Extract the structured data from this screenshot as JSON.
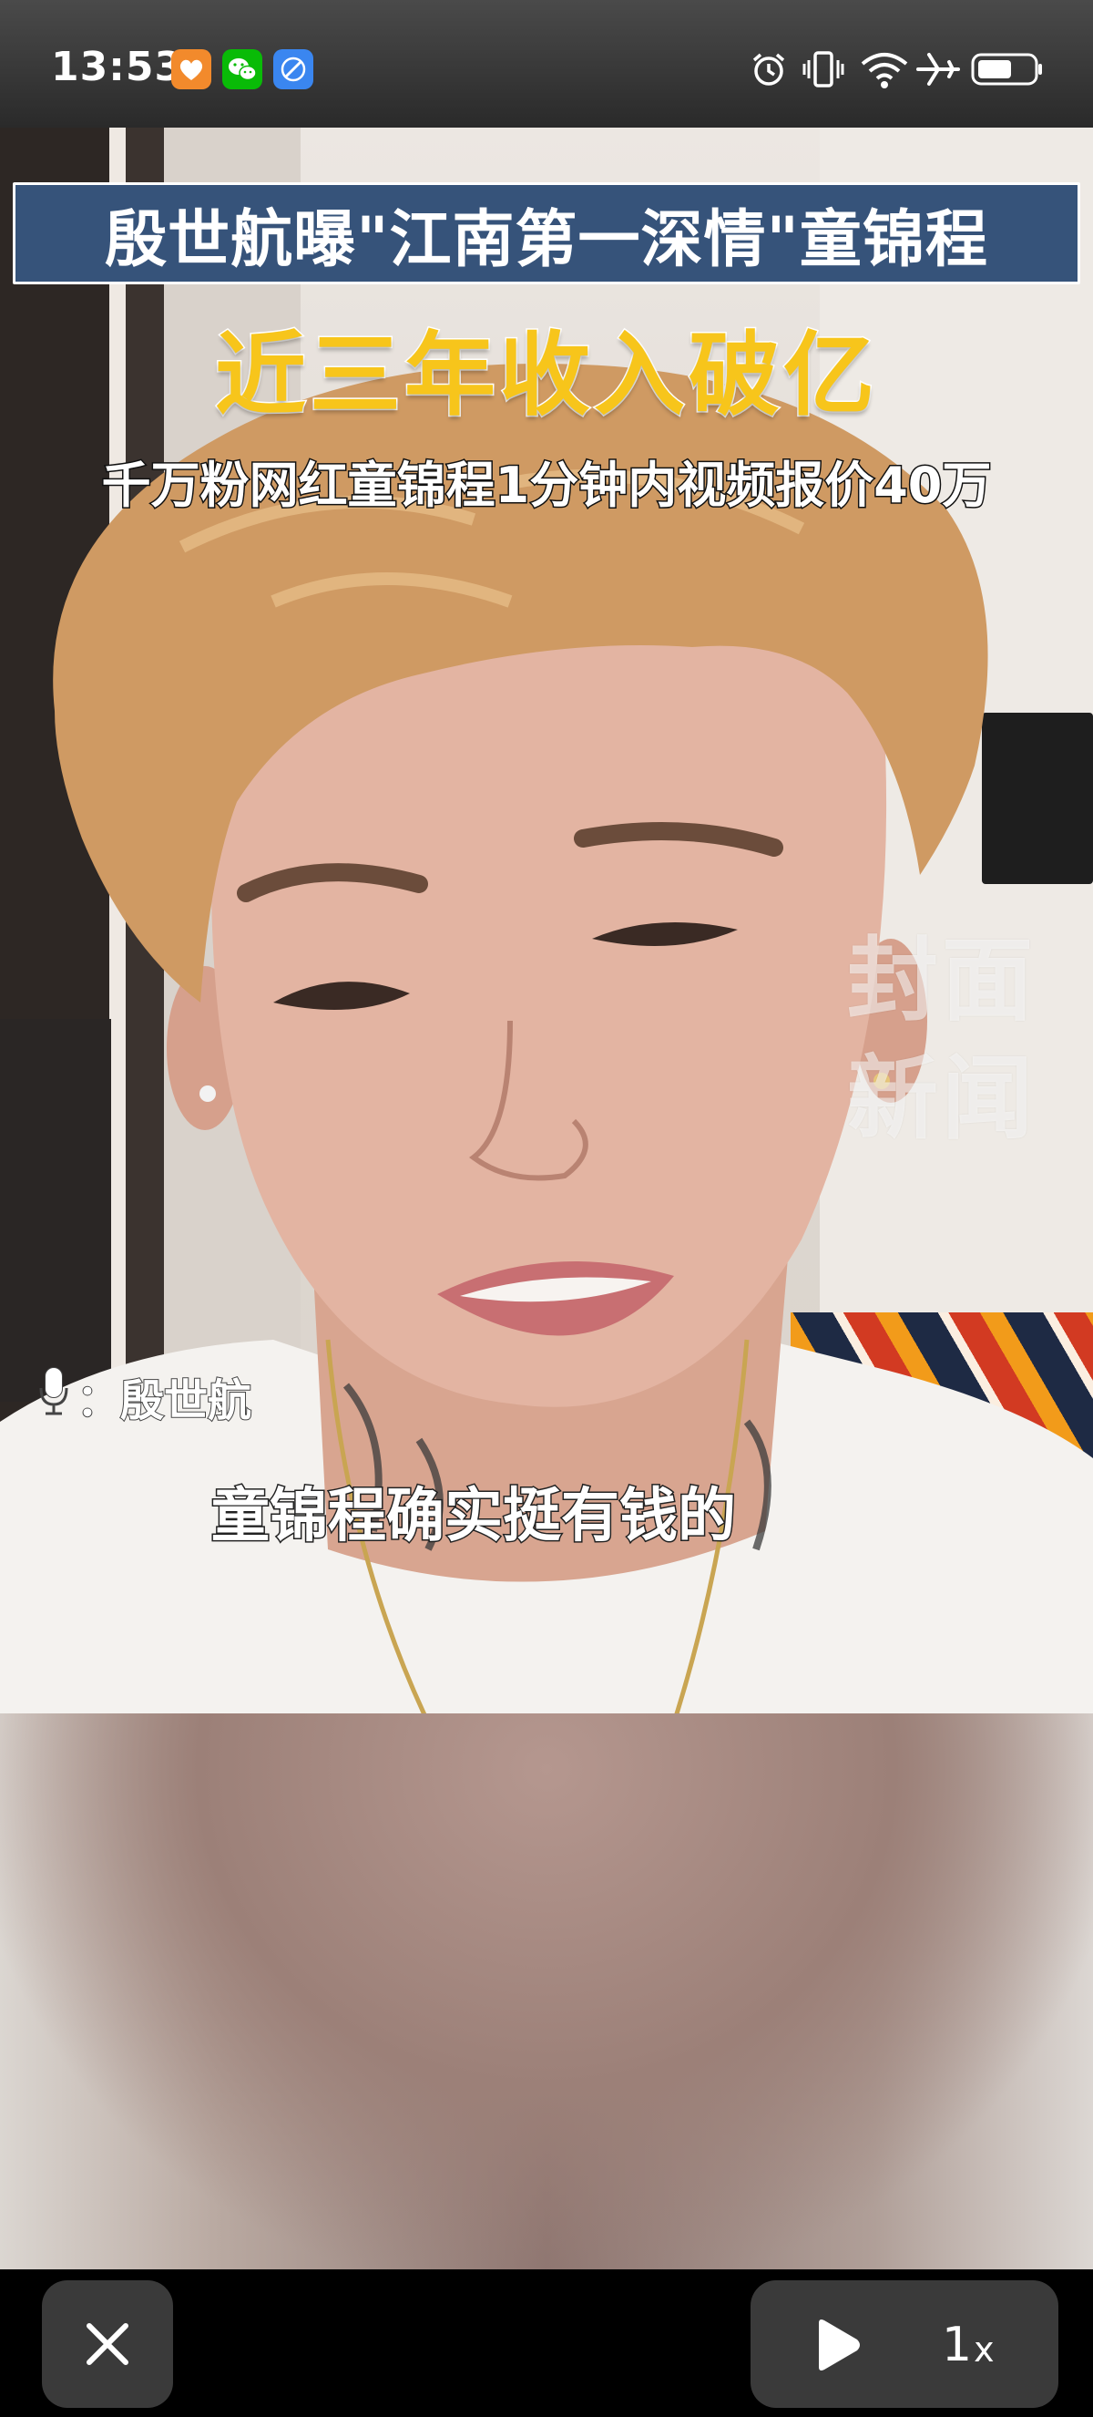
{
  "status_bar": {
    "time": "13:53",
    "notifications": [
      "heart-app-icon",
      "wechat-icon",
      "browser-icon"
    ],
    "indicators": [
      "alarm-icon",
      "vibrate-icon",
      "wifi-icon",
      "airplane-mode-icon",
      "battery-icon"
    ]
  },
  "video": {
    "headline": "殷世航曝\"江南第一深情\"童锦程",
    "sub_headline": "近三年收入破亿",
    "info_line": "千万粉网红童锦程1分钟内视频报价40万",
    "speaker_label": "：殷世航",
    "caption": "童锦程确实挺有钱的",
    "watermark": "封面\n新闻"
  },
  "controls": {
    "speed_value": "1",
    "speed_unit": "x"
  },
  "colors": {
    "headline_bg": "#36537a",
    "sub_headline": "#f7c51b",
    "control_bg": "#3a3a3a"
  }
}
